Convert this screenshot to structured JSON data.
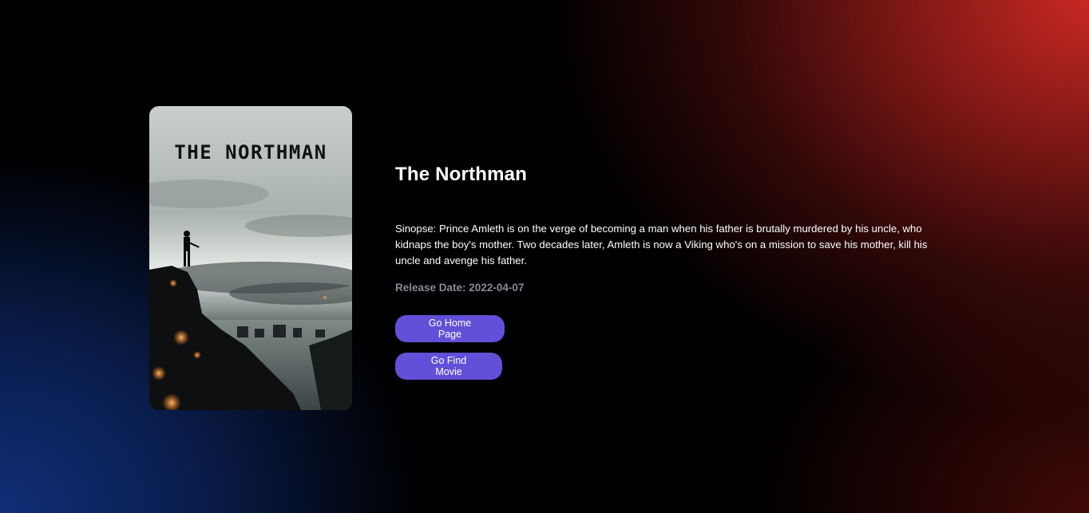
{
  "movie": {
    "title": "The Northman",
    "poster_title": "THE NORTHMAN",
    "synopsis": "Sinopse: Prince Amleth is on the verge of becoming a man when his father is brutally murdered by his uncle, who kidnaps the boy's mother. Two decades later, Amleth is now a Viking who's on a mission to save his mother, kill his uncle and avenge his father.",
    "release": "Release Date: 2022-04-07"
  },
  "buttons": {
    "home_label": "Go Home Page",
    "find_label": "Go Find Movie"
  },
  "colors": {
    "button_bg": "#6350d8",
    "release_text": "#8a8a94",
    "gradient_top_right": "#c82823",
    "gradient_bottom_left": "#102e78"
  }
}
